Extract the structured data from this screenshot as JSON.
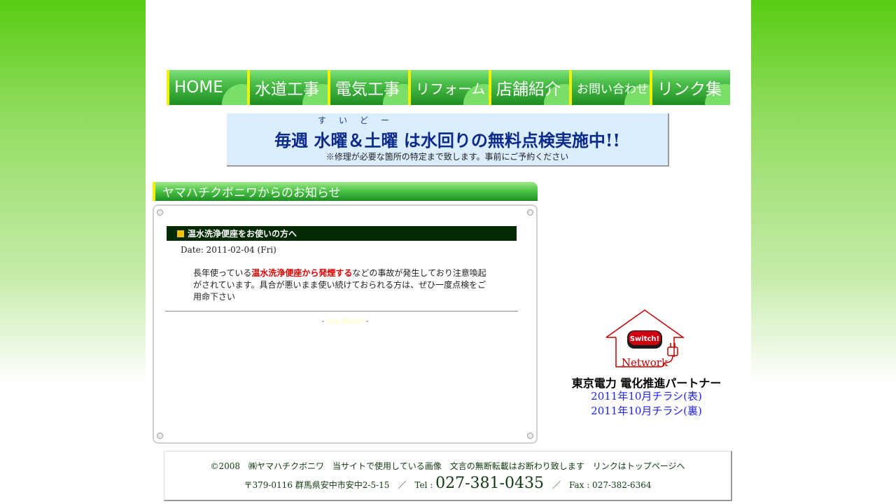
{
  "nav": {
    "items": [
      {
        "label": "HOME"
      },
      {
        "label": "水道工事"
      },
      {
        "label": "電気工事"
      },
      {
        "label": "リフォーム"
      },
      {
        "label": "店舗紹介"
      },
      {
        "label": "お問い合わせ"
      },
      {
        "label": "リンク集"
      }
    ]
  },
  "banner": {
    "ruby": "すいどー",
    "headline": "毎週 水曜＆土曜 は水回りの無料点検実施中!!",
    "note": "※修理が必要な箇所の特定まで致します。事前にご予約ください"
  },
  "notice": {
    "header": "ヤマハチクボニワからのお知らせ",
    "article": {
      "title": "温水洗浄便座をお使いの方へ",
      "date": "Date: 2011-02-04 (Fri)",
      "body_before": "長年使っている",
      "body_highlight": "温水洗浄便座から発煙する",
      "body_after": "などの事故が発生しており注意喚起がされています。具合が悪いまま使い続けておられる方は、ぜひ一度点検をご用命下さい"
    },
    "credit_prefix": "- ",
    "credit_link": "Sun Board",
    "credit_suffix": " -"
  },
  "sidebar": {
    "logo_button_text": "Switch!",
    "logo_network_text": "Network",
    "partner": "東京電力 電化推進パートナー",
    "links": [
      {
        "label": "2011年10月チラシ(表)"
      },
      {
        "label": "2011年10月チラシ(裏)"
      }
    ]
  },
  "footer": {
    "line1": "©2008　㈱ヤマハチクボニワ　当サイトで使用している画像　文言の無断転載はお断わり致します　リンクはトップページへ",
    "address": "〒379-0116 群馬県安中市安中2-5-15　／　Tel : ",
    "tel": "027-381-0435",
    "fax": "　／　Fax : 027-382-6364"
  },
  "colors": {
    "nav_green": "#1f8e24",
    "nav_accent": "#f2f200",
    "banner_bg": "#dbeeff",
    "title_bar": "#032a03",
    "highlight_red": "#e00000",
    "link_blue": "#2222ee"
  }
}
